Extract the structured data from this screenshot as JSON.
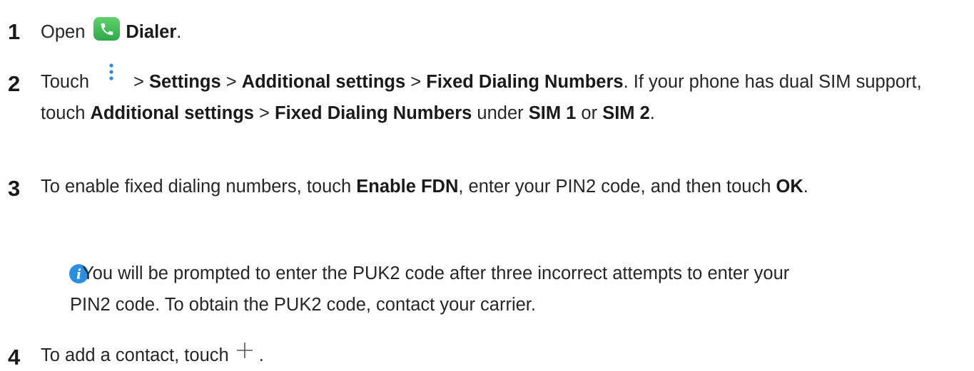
{
  "steps": [
    {
      "number": "1",
      "parts": {
        "t1": "Open",
        "b1": "Dialer",
        "t2": "."
      }
    },
    {
      "number": "2",
      "parts": {
        "t1": "Touch",
        "t2": "> ",
        "b1": "Settings",
        "t3": " > ",
        "b2": "Additional settings",
        "t4": " > ",
        "b3": "Fixed Dialing Numbers",
        "t5": ". If your phone has dual SIM support, touch ",
        "b4": "Additional settings",
        "t6": " > ",
        "b5": "Fixed Dialing Numbers",
        "t7": " under ",
        "b6": "SIM 1",
        "t8": " or ",
        "b7": "SIM 2",
        "t9": "."
      }
    },
    {
      "number": "3",
      "parts": {
        "t1": "To enable fixed dialing numbers, touch ",
        "b1": "Enable FDN",
        "t2": ", enter your PIN2 code, and then touch ",
        "b2": "OK",
        "t3": "."
      }
    },
    {
      "number": "4",
      "parts": {
        "t1": "To add a contact, touch",
        "t2": "."
      }
    }
  ],
  "note": {
    "line1": "You will be prompted to enter the PUK2 code after three incorrect attempts to enter your",
    "line2": "PIN2 code. To obtain the PUK2 code, contact your carrier."
  },
  "icons": {
    "dialer": "phone-app-icon",
    "more": "more-vertical-icon",
    "info": "info-icon",
    "add": "plus-icon"
  },
  "colors": {
    "dialer_icon": "#3dbb55",
    "more_icon": "#2a8fe0",
    "info_icon": "#2a8fe0",
    "text": "#262626"
  }
}
